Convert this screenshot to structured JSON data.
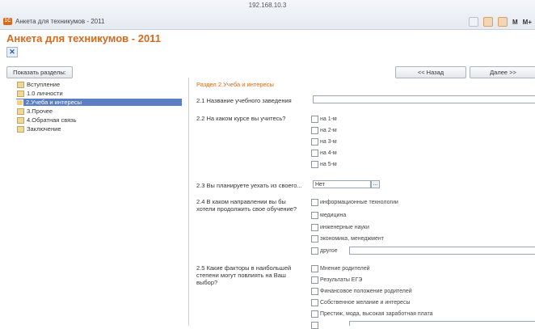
{
  "window": {
    "address": "192.168.10.3",
    "tab_title": "Анкета для техникумов - 2011",
    "app_icon_text": "1С",
    "right_labels": [
      "М",
      "М+"
    ]
  },
  "page": {
    "title": "Анкета для техникумов - 2011",
    "close_symbol": "✕"
  },
  "toolbar": {
    "show_sections": "Показать разделы:",
    "back": "<< Назад",
    "next": "Далее >>"
  },
  "tree": {
    "items": [
      "Вступление",
      "1.0 личности",
      "2.Учеба и интересы",
      "3.Прочее",
      "4.Обратная связь",
      "Заключение"
    ],
    "selected_index": 2
  },
  "section": {
    "title": "Раздел 2.Учеба и интересы",
    "q1": {
      "label": "2.1 Название учебного заведения",
      "value": ""
    },
    "q2": {
      "label": "2.2 На каком курсе вы учитесь?",
      "options": [
        "на 1-м",
        "на 2-м",
        "на 3-м",
        "на 4-м",
        "на 5-м"
      ]
    },
    "q3": {
      "label": "2.3 Вы планируете уехать из своего...",
      "value": "Нет",
      "button": "..."
    },
    "q4": {
      "label": "2.4 В каком направлении вы бы хотели продолжить свое обучение?",
      "options": [
        "информационные технологии",
        "медицина",
        "инженерные науки",
        "экономика, менеджмент",
        "другое"
      ]
    },
    "q5": {
      "label": "2.5 Какие факторы в наибольшей степени могут повлиять на Ваш выбор?",
      "options": [
        "Мнение родителей",
        "Результаты ЕГЭ",
        "Финансовое положение родителей",
        "Собственное желание и интересы",
        "Престиж, мода, высокая заработная плата"
      ]
    }
  }
}
